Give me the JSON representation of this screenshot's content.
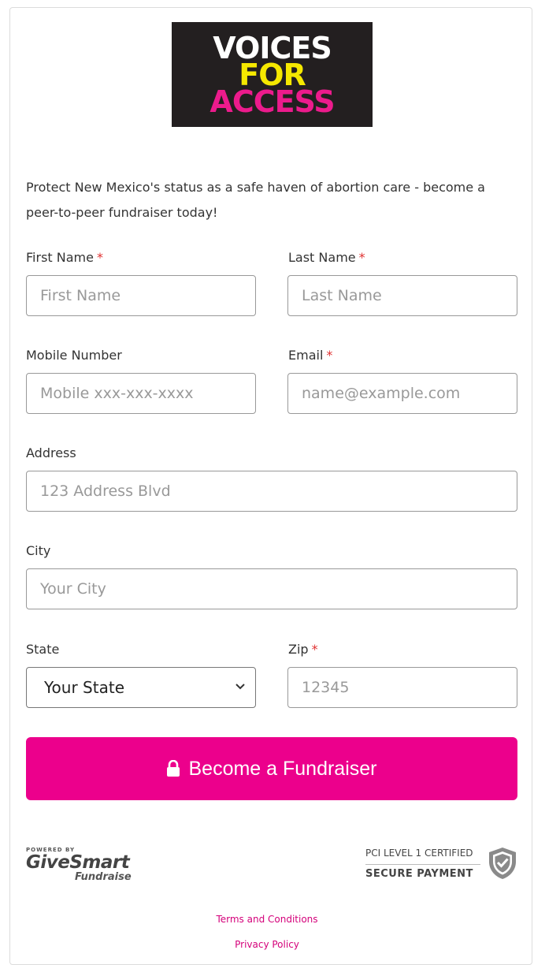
{
  "logo": {
    "line1": "VOICES",
    "line2": "FOR",
    "line3": "ACCESS"
  },
  "intro": "Protect New Mexico's status as a safe haven of abortion care - become a peer-to-peer fundraiser today!",
  "form": {
    "first_name": {
      "label": "First Name",
      "required": "*",
      "placeholder": "First Name"
    },
    "last_name": {
      "label": "Last Name",
      "required": "*",
      "placeholder": "Last Name"
    },
    "mobile": {
      "label": "Mobile Number",
      "placeholder": "Mobile xxx-xxx-xxxx"
    },
    "email": {
      "label": "Email",
      "required": "*",
      "placeholder": "name@example.com"
    },
    "address": {
      "label": "Address",
      "placeholder": "123 Address Blvd"
    },
    "city": {
      "label": "City",
      "placeholder": "Your City"
    },
    "state": {
      "label": "State",
      "value": "Your State"
    },
    "zip": {
      "label": "Zip",
      "required": "*",
      "placeholder": "12345"
    }
  },
  "submit_label": "Become a Fundraiser",
  "footer": {
    "powered_by": "POWERED BY",
    "brand": "GiveSmart",
    "brand_sub": "Fundraise",
    "pci_line1": "PCI LEVEL 1 CERTIFIED",
    "pci_line2": "SECURE PAYMENT",
    "terms": "Terms and Conditions",
    "privacy": "Privacy Policy"
  },
  "colors": {
    "accent": "#ec008c",
    "required": "#e03030",
    "logo_bg": "#231f20",
    "logo_yellow": "#f5e800",
    "logo_pink": "#ec1b8c"
  }
}
